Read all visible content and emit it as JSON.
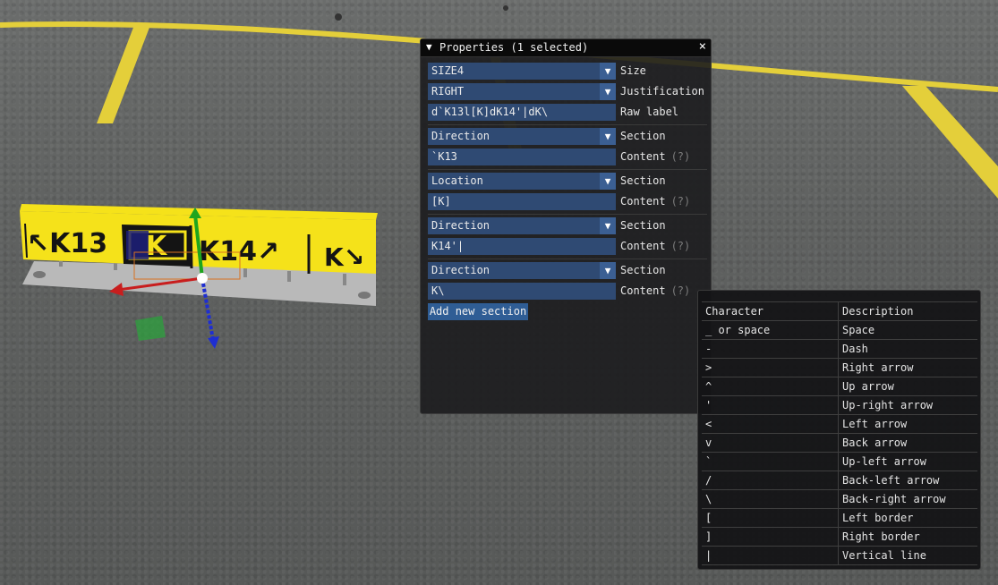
{
  "window": {
    "title": "Properties (1 selected)",
    "collapse_icon": "triangle-down-icon",
    "close_icon": "close-icon",
    "close_glyph": "×",
    "dropdown_glyph": "▼",
    "collapse_glyph": "▼"
  },
  "properties": {
    "size": {
      "value": "SIZE4",
      "label": "Size"
    },
    "justification": {
      "value": "RIGHT",
      "label": "Justification"
    },
    "raw_label": {
      "value": "d`K13l[K]dK14'|dK\\",
      "label": "Raw label"
    }
  },
  "sections": [
    {
      "type": "Direction",
      "type_label": "Section",
      "content": "`K13",
      "content_label": "Content",
      "help": "(?)"
    },
    {
      "type": "Location",
      "type_label": "Section",
      "content": "[K]",
      "content_label": "Content",
      "help": "(?)"
    },
    {
      "type": "Direction",
      "type_label": "Section",
      "content": "K14'|",
      "content_label": "Content",
      "help": "(?)"
    },
    {
      "type": "Direction",
      "type_label": "Section",
      "content": "K\\",
      "content_label": "Content",
      "help": "(?)"
    }
  ],
  "add_section_label": "Add new section",
  "help_table": {
    "headers": [
      "Character",
      "Description"
    ],
    "rows": [
      [
        "_ or space",
        "Space"
      ],
      [
        "-",
        "Dash"
      ],
      [
        ">",
        "Right arrow"
      ],
      [
        "^",
        "Up arrow"
      ],
      [
        "'",
        "Up-right arrow"
      ],
      [
        "<",
        "Left arrow"
      ],
      [
        "v",
        "Back arrow"
      ],
      [
        "`",
        "Up-left arrow"
      ],
      [
        "/",
        "Back-left arrow"
      ],
      [
        "\\",
        "Back-right arrow"
      ],
      [
        "[",
        "Left border"
      ],
      [
        "]",
        "Right border"
      ],
      [
        "|",
        "Vertical line"
      ]
    ]
  },
  "sign": {
    "panels": [
      "↖K13",
      "K",
      "K14↗",
      "K↘"
    ]
  },
  "colors": {
    "sign_yellow": "#f5e21a",
    "sign_black": "#141414",
    "taxi_line": "#e4cf3a",
    "field_bg": "#2f4a73",
    "gizmo_x": "#c81e1e",
    "gizmo_y": "#1ea51e",
    "gizmo_z": "#1e2ed2"
  }
}
